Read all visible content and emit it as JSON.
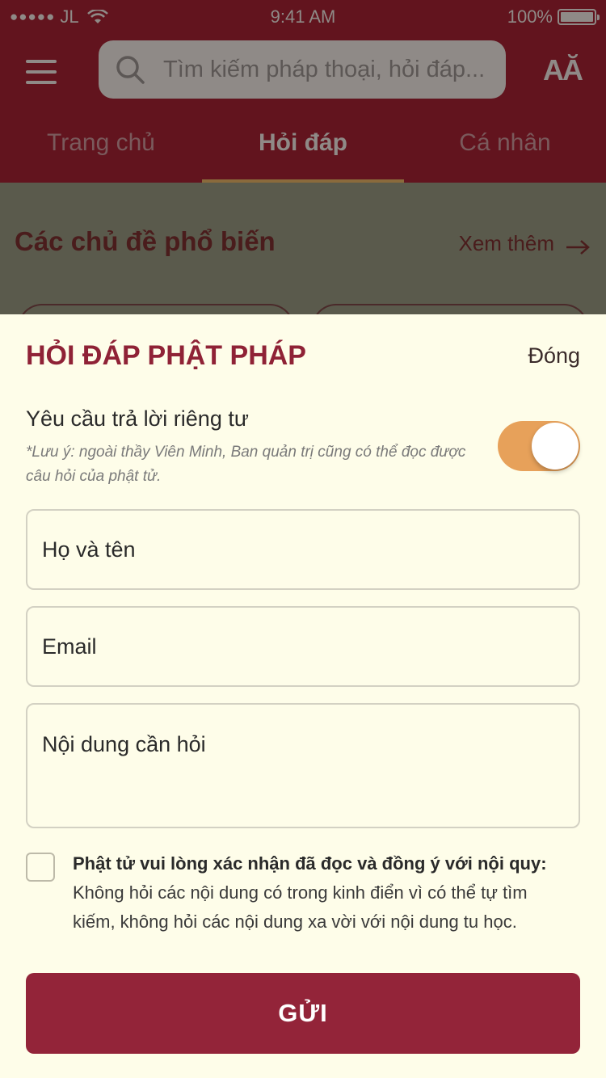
{
  "status_bar": {
    "carrier": "JL",
    "time": "9:41 AM",
    "battery": "100%"
  },
  "header": {
    "search_placeholder": "Tìm kiếm pháp thoại, hỏi đáp...",
    "font_size_label": "AĂ",
    "tabs": [
      {
        "label": "Trang chủ",
        "active": false
      },
      {
        "label": "Hỏi đáp",
        "active": true
      },
      {
        "label": "Cá nhân",
        "active": false
      }
    ]
  },
  "popular": {
    "title": "Các chủ đề phổ biến",
    "see_more": "Xem thêm"
  },
  "modal": {
    "title": "HỎI ĐÁP PHẬT PHÁP",
    "close_label": "Đóng",
    "private_label": "Yêu cầu trả lời riêng tư",
    "private_note": "*Lưu ý: ngoài thầy Viên Minh, Ban quản trị cũng  có thể đọc được câu hỏi của phật tử.",
    "private_enabled": true,
    "fields": {
      "name_placeholder": "Họ và tên",
      "email_placeholder": "Email",
      "content_placeholder": "Nội dung cần hỏi"
    },
    "terms_bold": "Phật tử vui lòng xác nhận đã đọc và đồng ý với nội quy:",
    "terms_text": "Không hỏi các nội dung có trong kinh điển vì có thể tự tìm kiếm, không hỏi các nội dung xa vời với nội dung tu học.",
    "terms_checked": false,
    "submit_label": "GỬI"
  },
  "colors": {
    "brand": "#932439",
    "toggle_on": "#e7a15a",
    "sheet_bg": "#fefde9"
  }
}
